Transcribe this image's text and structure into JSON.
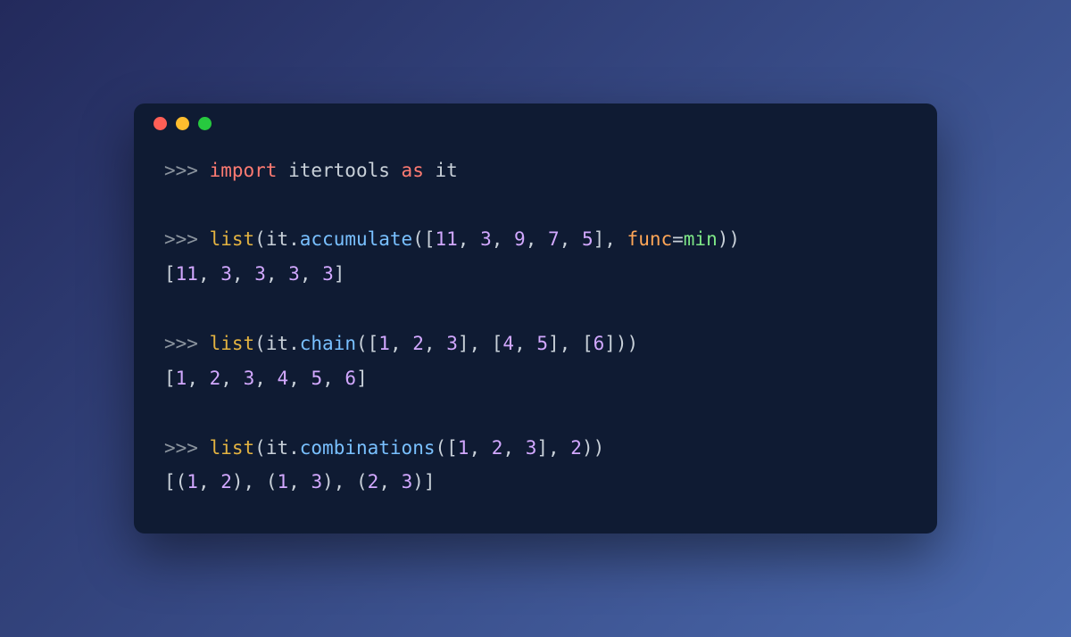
{
  "titlebar": {
    "buttons": [
      "close",
      "minimize",
      "zoom"
    ]
  },
  "code": {
    "lines": [
      {
        "type": "input",
        "tokens": [
          {
            "t": ">>> ",
            "c": "tok-prompt"
          },
          {
            "t": "import",
            "c": "tok-keyword"
          },
          {
            "t": " ",
            "c": "tok-punct"
          },
          {
            "t": "itertools",
            "c": "tok-module"
          },
          {
            "t": " ",
            "c": "tok-punct"
          },
          {
            "t": "as",
            "c": "tok-keyword"
          },
          {
            "t": " ",
            "c": "tok-punct"
          },
          {
            "t": "it",
            "c": "tok-module"
          }
        ]
      },
      {
        "type": "blank"
      },
      {
        "type": "input",
        "tokens": [
          {
            "t": ">>> ",
            "c": "tok-prompt"
          },
          {
            "t": "list",
            "c": "tok-func"
          },
          {
            "t": "(",
            "c": "tok-punct"
          },
          {
            "t": "it",
            "c": "tok-module"
          },
          {
            "t": ".",
            "c": "tok-punct"
          },
          {
            "t": "accumulate",
            "c": "tok-attr"
          },
          {
            "t": "([",
            "c": "tok-punct"
          },
          {
            "t": "11",
            "c": "tok-num"
          },
          {
            "t": ", ",
            "c": "tok-punct"
          },
          {
            "t": "3",
            "c": "tok-num"
          },
          {
            "t": ", ",
            "c": "tok-punct"
          },
          {
            "t": "9",
            "c": "tok-num"
          },
          {
            "t": ", ",
            "c": "tok-punct"
          },
          {
            "t": "7",
            "c": "tok-num"
          },
          {
            "t": ", ",
            "c": "tok-punct"
          },
          {
            "t": "5",
            "c": "tok-num"
          },
          {
            "t": "], ",
            "c": "tok-punct"
          },
          {
            "t": "func",
            "c": "tok-param"
          },
          {
            "t": "=",
            "c": "tok-punct"
          },
          {
            "t": "min",
            "c": "tok-builtin"
          },
          {
            "t": "))",
            "c": "tok-punct"
          }
        ]
      },
      {
        "type": "output",
        "tokens": [
          {
            "t": "[",
            "c": "tok-punct"
          },
          {
            "t": "11",
            "c": "tok-num"
          },
          {
            "t": ", ",
            "c": "tok-punct"
          },
          {
            "t": "3",
            "c": "tok-num"
          },
          {
            "t": ", ",
            "c": "tok-punct"
          },
          {
            "t": "3",
            "c": "tok-num"
          },
          {
            "t": ", ",
            "c": "tok-punct"
          },
          {
            "t": "3",
            "c": "tok-num"
          },
          {
            "t": ", ",
            "c": "tok-punct"
          },
          {
            "t": "3",
            "c": "tok-num"
          },
          {
            "t": "]",
            "c": "tok-punct"
          }
        ]
      },
      {
        "type": "blank"
      },
      {
        "type": "input",
        "tokens": [
          {
            "t": ">>> ",
            "c": "tok-prompt"
          },
          {
            "t": "list",
            "c": "tok-func"
          },
          {
            "t": "(",
            "c": "tok-punct"
          },
          {
            "t": "it",
            "c": "tok-module"
          },
          {
            "t": ".",
            "c": "tok-punct"
          },
          {
            "t": "chain",
            "c": "tok-attr"
          },
          {
            "t": "([",
            "c": "tok-punct"
          },
          {
            "t": "1",
            "c": "tok-num"
          },
          {
            "t": ", ",
            "c": "tok-punct"
          },
          {
            "t": "2",
            "c": "tok-num"
          },
          {
            "t": ", ",
            "c": "tok-punct"
          },
          {
            "t": "3",
            "c": "tok-num"
          },
          {
            "t": "], [",
            "c": "tok-punct"
          },
          {
            "t": "4",
            "c": "tok-num"
          },
          {
            "t": ", ",
            "c": "tok-punct"
          },
          {
            "t": "5",
            "c": "tok-num"
          },
          {
            "t": "], [",
            "c": "tok-punct"
          },
          {
            "t": "6",
            "c": "tok-num"
          },
          {
            "t": "]))",
            "c": "tok-punct"
          }
        ]
      },
      {
        "type": "output",
        "tokens": [
          {
            "t": "[",
            "c": "tok-punct"
          },
          {
            "t": "1",
            "c": "tok-num"
          },
          {
            "t": ", ",
            "c": "tok-punct"
          },
          {
            "t": "2",
            "c": "tok-num"
          },
          {
            "t": ", ",
            "c": "tok-punct"
          },
          {
            "t": "3",
            "c": "tok-num"
          },
          {
            "t": ", ",
            "c": "tok-punct"
          },
          {
            "t": "4",
            "c": "tok-num"
          },
          {
            "t": ", ",
            "c": "tok-punct"
          },
          {
            "t": "5",
            "c": "tok-num"
          },
          {
            "t": ", ",
            "c": "tok-punct"
          },
          {
            "t": "6",
            "c": "tok-num"
          },
          {
            "t": "]",
            "c": "tok-punct"
          }
        ]
      },
      {
        "type": "blank"
      },
      {
        "type": "input",
        "tokens": [
          {
            "t": ">>> ",
            "c": "tok-prompt"
          },
          {
            "t": "list",
            "c": "tok-func"
          },
          {
            "t": "(",
            "c": "tok-punct"
          },
          {
            "t": "it",
            "c": "tok-module"
          },
          {
            "t": ".",
            "c": "tok-punct"
          },
          {
            "t": "combinations",
            "c": "tok-attr"
          },
          {
            "t": "([",
            "c": "tok-punct"
          },
          {
            "t": "1",
            "c": "tok-num"
          },
          {
            "t": ", ",
            "c": "tok-punct"
          },
          {
            "t": "2",
            "c": "tok-num"
          },
          {
            "t": ", ",
            "c": "tok-punct"
          },
          {
            "t": "3",
            "c": "tok-num"
          },
          {
            "t": "], ",
            "c": "tok-punct"
          },
          {
            "t": "2",
            "c": "tok-num"
          },
          {
            "t": "))",
            "c": "tok-punct"
          }
        ]
      },
      {
        "type": "output",
        "tokens": [
          {
            "t": "[(",
            "c": "tok-punct"
          },
          {
            "t": "1",
            "c": "tok-num"
          },
          {
            "t": ", ",
            "c": "tok-punct"
          },
          {
            "t": "2",
            "c": "tok-num"
          },
          {
            "t": "), (",
            "c": "tok-punct"
          },
          {
            "t": "1",
            "c": "tok-num"
          },
          {
            "t": ", ",
            "c": "tok-punct"
          },
          {
            "t": "3",
            "c": "tok-num"
          },
          {
            "t": "), (",
            "c": "tok-punct"
          },
          {
            "t": "2",
            "c": "tok-num"
          },
          {
            "t": ", ",
            "c": "tok-punct"
          },
          {
            "t": "3",
            "c": "tok-num"
          },
          {
            "t": ")]",
            "c": "tok-punct"
          }
        ]
      }
    ]
  }
}
